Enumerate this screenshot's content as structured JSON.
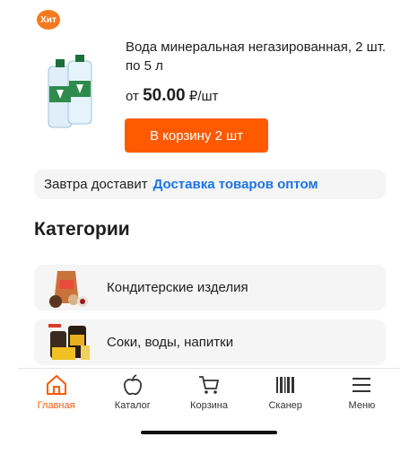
{
  "product": {
    "badge": "Хит",
    "title": "Вода минеральная негазированная, 2 шт. по 5 л",
    "price_prefix": "от",
    "price_value": "50.00",
    "price_unit": "₽/шт",
    "cart_button": "В корзину 2 шт"
  },
  "delivery": {
    "text": "Завтра доставит",
    "link": "Доставка товаров оптом"
  },
  "categories": {
    "title": "Категории",
    "items": [
      {
        "label": "Кондитерские изделия",
        "icon": "confectionery-image"
      },
      {
        "label": "Соки, воды, напитки",
        "icon": "drinks-image"
      }
    ]
  },
  "tabbar": {
    "items": [
      {
        "label": "Главная",
        "icon": "home-icon",
        "active": true
      },
      {
        "label": "Каталог",
        "icon": "apple-icon",
        "active": false
      },
      {
        "label": "Корзина",
        "icon": "cart-icon",
        "active": false
      },
      {
        "label": "Сканер",
        "icon": "barcode-icon",
        "active": false
      },
      {
        "label": "Меню",
        "icon": "menu-icon",
        "active": false
      }
    ]
  },
  "colors": {
    "accent": "#ff5a00",
    "link": "#1a73e8",
    "badge": "#f47a20",
    "card_bg": "#f5f5f5"
  }
}
